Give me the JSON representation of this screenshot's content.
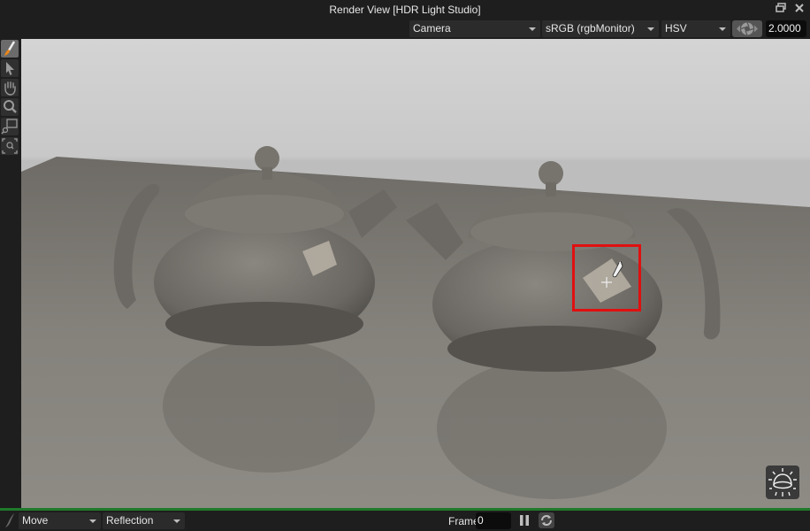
{
  "window": {
    "title": "Render View [HDR Light Studio]",
    "restore_icon": "restore-window-icon",
    "close_icon": "close-icon"
  },
  "toolbar": {
    "camera_select": "Camera",
    "colorspace_select": "sRGB (rgbMonitor)",
    "colormodel_select": "HSV",
    "exposure_icon": "aperture-icon",
    "exposure_value": "2.0000"
  },
  "side_tools": [
    {
      "name": "paint-light-tool",
      "icon": "brush-icon",
      "active": true
    },
    {
      "name": "select-tool",
      "icon": "arrow-cursor-icon",
      "active": false
    },
    {
      "name": "pan-tool",
      "icon": "hand-icon",
      "active": false
    },
    {
      "name": "zoom-tool",
      "icon": "magnifier-icon",
      "active": false
    },
    {
      "name": "zoom-region-tool",
      "icon": "zoom-region-icon",
      "active": false
    },
    {
      "name": "zoom-fit-tool",
      "icon": "zoom-fit-icon",
      "active": false
    }
  ],
  "viewport": {
    "content": "Two grey metallic-flake teapots on a reflective floor with a light highlight selected",
    "selection_color": "#e01010",
    "sky_toggle_icon": "sky-dome-icon"
  },
  "bottom_bar": {
    "brush_icon": "brush-icon",
    "mode_select": "Move",
    "placement_select": "Reflection",
    "frame_label": "Frame",
    "frame_value": "0",
    "pause_icon": "pause-icon",
    "refresh_icon": "refresh-icon"
  },
  "colors": {
    "accent_green": "#1f7a2a",
    "background": "#1e1e1e"
  }
}
